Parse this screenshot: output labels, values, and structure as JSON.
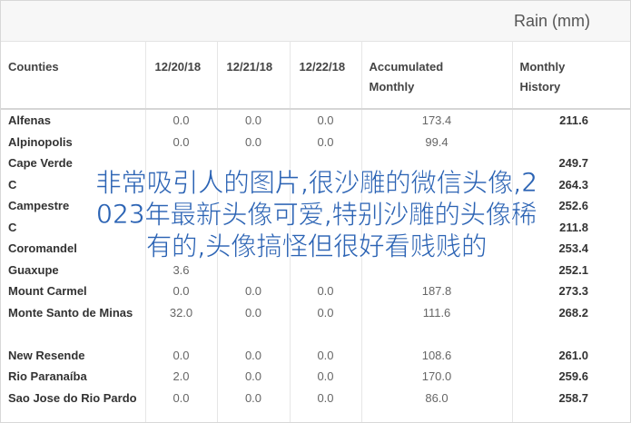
{
  "header": {
    "rain_label": "Rain (mm)"
  },
  "table": {
    "columns": [
      "Counties",
      "12/20/18",
      "12/21/18",
      "12/22/18",
      "Accumulated Monthly",
      "Monthly History"
    ],
    "rows": [
      {
        "county": "Alfenas",
        "d1": "0.0",
        "d2": "0.0",
        "d3": "0.0",
        "acc": "173.4",
        "hist": "211.6"
      },
      {
        "county": "Alpinopolis",
        "d1": "0.0",
        "d2": "0.0",
        "d3": "0.0",
        "acc": "99.4",
        "hist": ""
      },
      {
        "county": "Cape Verde",
        "d1": "",
        "d2": "",
        "d3": "",
        "acc": "",
        "hist": "249.7"
      },
      {
        "county": "C",
        "d1": "",
        "d2": "",
        "d3": "",
        "acc": "",
        "hist": "264.3"
      },
      {
        "county": "Campestre",
        "d1": "",
        "d2": "",
        "d3": "",
        "acc": "",
        "hist": "252.6"
      },
      {
        "county": "C",
        "d1": "",
        "d2": "",
        "d3": "",
        "acc": "",
        "hist": "211.8"
      },
      {
        "county": "Coromandel",
        "d1": "",
        "d2": "",
        "d3": "",
        "acc": "",
        "hist": "253.4"
      },
      {
        "county": "Guaxupe",
        "d1": "3.6",
        "d2": "",
        "d3": "",
        "acc": "",
        "hist": "252.1"
      },
      {
        "county": "Mount Carmel",
        "d1": "0.0",
        "d2": "0.0",
        "d3": "0.0",
        "acc": "187.8",
        "hist": "273.3"
      },
      {
        "county": "Monte Santo de Minas",
        "d1": "32.0",
        "d2": "0.0",
        "d3": "0.0",
        "acc": "111.6",
        "hist": "268.2"
      },
      {
        "county": "New Resende",
        "d1": "0.0",
        "d2": "0.0",
        "d3": "0.0",
        "acc": "108.6",
        "hist": "261.0"
      },
      {
        "county": "Rio Paranaíba",
        "d1": "2.0",
        "d2": "0.0",
        "d3": "0.0",
        "acc": "170.0",
        "hist": "259.6"
      },
      {
        "county": "Sao Jose do Rio Pardo",
        "d1": "0.0",
        "d2": "0.0",
        "d3": "0.0",
        "acc": "86.0",
        "hist": "258.7"
      }
    ]
  },
  "overlay": {
    "line1": "非常吸引人的图片,很沙雕的微信头像,2",
    "line2": "023年最新头像可爱,特别沙雕的头像稀",
    "line3": "有的,头像搞怪但很好看贱贱的",
    "color": "#2b63b4"
  }
}
